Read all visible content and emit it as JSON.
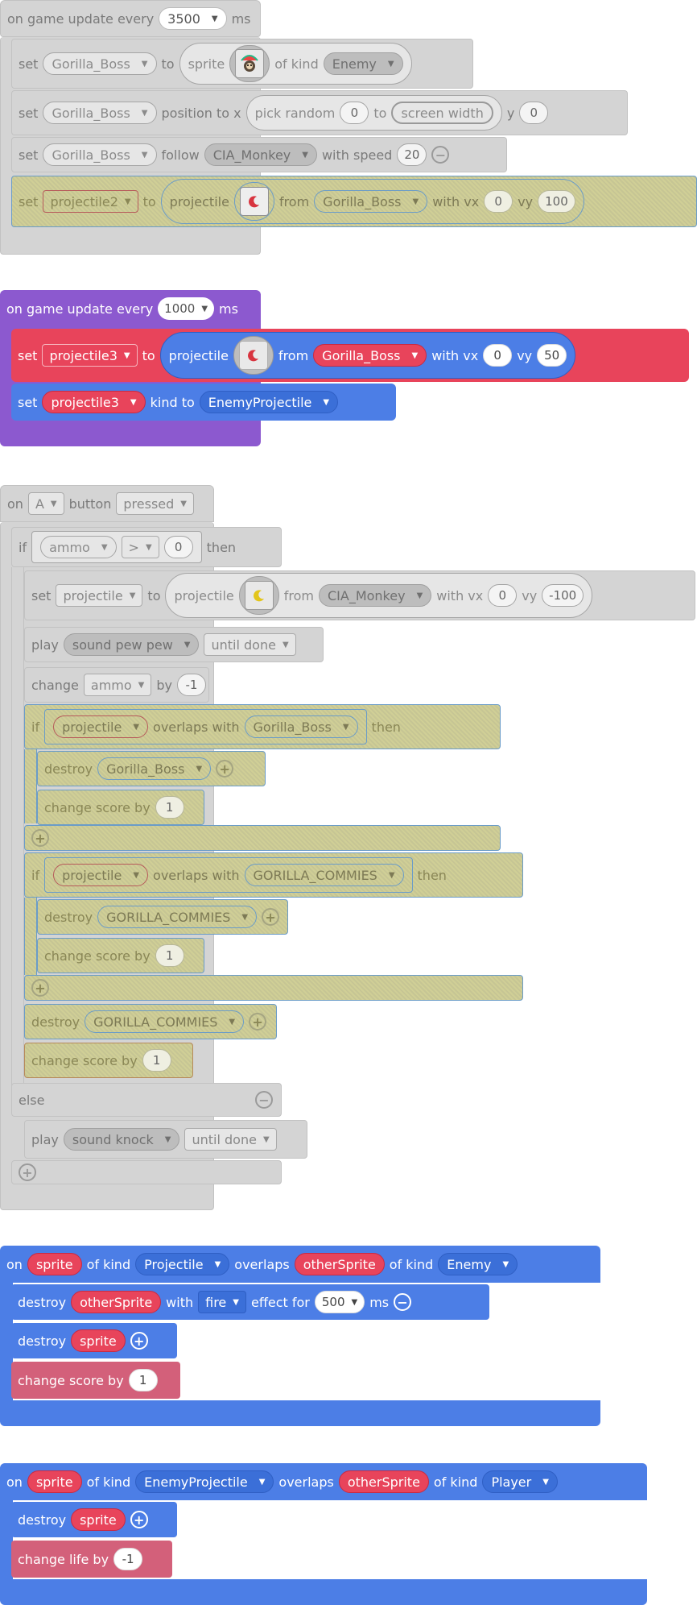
{
  "g1": {
    "hat": {
      "prefix": "on game update every",
      "interval": "3500",
      "suffix": "ms"
    },
    "row1": {
      "set": "set",
      "var": "Gorilla_Boss",
      "to": "to",
      "sprite": "sprite",
      "of_kind": "of kind",
      "kind": "Enemy",
      "image_icon": "gorilla-sprite-icon"
    },
    "row2": {
      "set": "set",
      "var": "Gorilla_Boss",
      "position": "position to x",
      "pick_random": "pick random",
      "from": "0",
      "to": "to",
      "max": "screen width",
      "y": "y",
      "y_val": "0"
    },
    "row3": {
      "set": "set",
      "var": "Gorilla_Boss",
      "follow": "follow",
      "target": "CIA_Monkey",
      "with_speed": "with speed",
      "speed": "20"
    },
    "row4": {
      "set": "set",
      "var": "projectile2",
      "to": "to",
      "projectile": "projectile",
      "from": "from",
      "source": "Gorilla_Boss",
      "with_vx": "with vx",
      "vx": "0",
      "vy_label": "vy",
      "vy": "100"
    }
  },
  "g2": {
    "hat": {
      "prefix": "on game update every",
      "interval": "1000",
      "suffix": "ms"
    },
    "row1": {
      "set": "set",
      "var": "projectile3",
      "to": "to",
      "projectile": "projectile",
      "from": "from",
      "source": "Gorilla_Boss",
      "with_vx": "with vx",
      "vx": "0",
      "vy_label": "vy",
      "vy": "50"
    },
    "row2": {
      "set": "set",
      "var": "projectile3",
      "kind_to": "kind to",
      "kind": "EnemyProjectile"
    }
  },
  "g3": {
    "hat": {
      "on": "on",
      "button": "A",
      "button_label": "button",
      "event": "pressed"
    },
    "if1": {
      "if": "if",
      "var": "ammo",
      "op": ">",
      "val": "0",
      "then": "then"
    },
    "set_proj": {
      "set": "set",
      "var": "projectile",
      "to": "to",
      "projectile": "projectile",
      "from": "from",
      "source": "CIA_Monkey",
      "with_vx": "with vx",
      "vx": "0",
      "vy_label": "vy",
      "vy": "-100"
    },
    "play1": {
      "play": "play",
      "sound": "sound pew pew",
      "mode": "until done"
    },
    "change_ammo": {
      "change": "change",
      "var": "ammo",
      "by": "by",
      "val": "-1"
    },
    "if2": {
      "if": "if",
      "a": "projectile",
      "overlaps": "overlaps with",
      "b": "Gorilla_Boss",
      "then": "then"
    },
    "destroy2": {
      "destroy": "destroy",
      "target": "Gorilla_Boss"
    },
    "score2": {
      "label": "change score by",
      "val": "1"
    },
    "if3": {
      "if": "if",
      "a": "projectile",
      "overlaps": "overlaps with",
      "b": "GORILLA_COMMIES",
      "then": "then"
    },
    "destroy3": {
      "destroy": "destroy",
      "target": "GORILLA_COMMIES"
    },
    "score3": {
      "label": "change score by",
      "val": "1"
    },
    "destroy4": {
      "destroy": "destroy",
      "target": "GORILLA_COMMIES"
    },
    "score4": {
      "label": "change score by",
      "val": "1"
    },
    "else": "else",
    "play2": {
      "play": "play",
      "sound": "sound knock",
      "mode": "until done"
    }
  },
  "g4": {
    "hat": {
      "on": "on",
      "a": "sprite",
      "of_kind": "of kind",
      "kind_a": "Projectile",
      "overlaps": "overlaps",
      "b": "otherSprite",
      "of_kind2": "of kind",
      "kind_b": "Enemy"
    },
    "row1": {
      "destroy": "destroy",
      "target": "otherSprite",
      "with": "with",
      "effect": "fire",
      "effect_for": "effect for",
      "duration": "500",
      "ms": "ms"
    },
    "row2": {
      "destroy": "destroy",
      "target": "sprite"
    },
    "row3": {
      "label": "change score by",
      "val": "1"
    }
  },
  "g5": {
    "hat": {
      "on": "on",
      "a": "sprite",
      "of_kind": "of kind",
      "kind_a": "EnemyProjectile",
      "overlaps": "overlaps",
      "b": "otherSprite",
      "of_kind2": "of kind",
      "kind_b": "Player"
    },
    "row1": {
      "destroy": "destroy",
      "target": "sprite"
    },
    "row2": {
      "label": "change life by",
      "val": "-1"
    }
  },
  "colors": {
    "event_blue": "#4c7ee6",
    "sprite_red": "#e8445b",
    "loop_purple": "#8c59cf",
    "info_pink": "#d3607a",
    "disabled": "#d4d4d4"
  }
}
